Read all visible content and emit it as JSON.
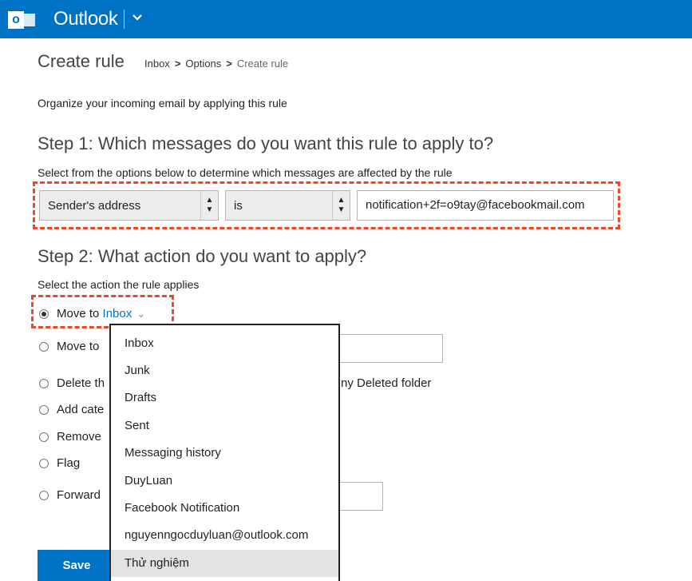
{
  "app": {
    "title": "Outlook",
    "logo_letter": "o"
  },
  "header": {
    "page_title": "Create rule",
    "breadcrumb": [
      "Inbox",
      "Options",
      "Create rule"
    ],
    "breadcrumb_separator": ">"
  },
  "intro": "Organize your incoming email by applying this rule",
  "step1": {
    "heading": "Step 1: Which messages do you want this rule to apply to?",
    "help": "Select from the options below to determine which messages are affected by the rule",
    "field_select": "Sender's address",
    "operator_select": "is",
    "value": "notification+2f=o9tay@facebookmail.com"
  },
  "step2": {
    "heading": "Step 2: What action do you want to apply?",
    "help": "Select the action the rule applies",
    "options": [
      {
        "prefix": "Move to",
        "link": "Inbox",
        "checked": true
      },
      {
        "label": "Move to",
        "checked": false
      },
      {
        "label": "Delete th",
        "checked": false
      },
      {
        "label": "Add cate",
        "checked": false
      },
      {
        "label": "Remove",
        "checked": false
      },
      {
        "label": "Flag",
        "checked": false
      },
      {
        "label": "Forward",
        "checked": false
      }
    ],
    "delete_suffix": "ny Deleted folder"
  },
  "folder_dropdown": {
    "items": [
      "Inbox",
      "Junk",
      "Drafts",
      "Sent",
      "Messaging history",
      "DuyLuan",
      "Facebook Notification",
      "nguyenngocduyluan@outlook.com",
      "Thử nghiệm"
    ],
    "highlighted_index": 8
  },
  "save_label": "Save",
  "colors": {
    "brand": "#0072c6",
    "highlight": "#e8482b"
  }
}
